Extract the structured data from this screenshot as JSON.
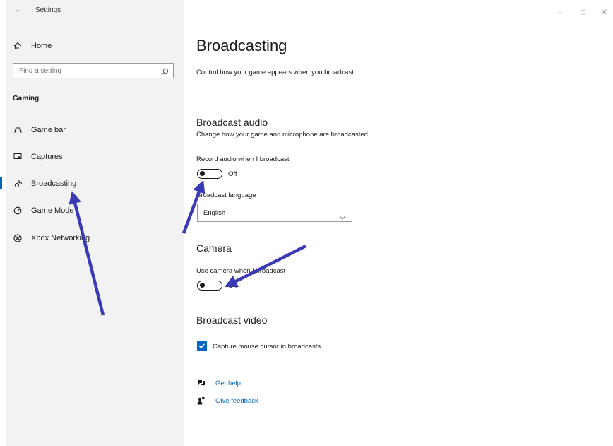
{
  "window": {
    "back_glyph": "←",
    "title": "Settings",
    "controls": {
      "minimize": "–",
      "maximize": "□",
      "close": "✕"
    }
  },
  "sidebar": {
    "home": {
      "label": "Home",
      "icon": "home-icon"
    },
    "search": {
      "placeholder": "Find a setting",
      "icon": "search-icon"
    },
    "section_title": "Gaming",
    "items": [
      {
        "label": "Game bar",
        "icon": "game-bar-icon"
      },
      {
        "label": "Captures",
        "icon": "captures-icon"
      },
      {
        "label": "Broadcasting",
        "icon": "broadcasting-icon",
        "active": true
      },
      {
        "label": "Game Mode",
        "icon": "game-mode-icon"
      },
      {
        "label": "Xbox Networking",
        "icon": "xbox-icon"
      }
    ]
  },
  "main": {
    "title": "Broadcasting",
    "description": "Control how your game appears when you broadcast.",
    "audio": {
      "heading": "Broadcast audio",
      "subtitle": "Change how your game and microphone are broadcasted.",
      "record_label": "Record audio when I broadcast",
      "record_state": "Off",
      "language_label": "Broadcast language",
      "language_value": "English"
    },
    "camera": {
      "heading": "Camera",
      "use_label": "Use camera when I broadcast",
      "use_state": "Off"
    },
    "video": {
      "heading": "Broadcast video",
      "capture_label": "Capture mouse cursor in broadcasts",
      "capture_checked": true
    },
    "links": [
      {
        "label": "Get help",
        "icon": "help-icon"
      },
      {
        "label": "Give feedback",
        "icon": "feedback-icon"
      }
    ]
  },
  "colors": {
    "accent": "#0067c0",
    "sidebar_bg": "#f2f2f2",
    "annotation_arrow": "#3a3ab4"
  }
}
